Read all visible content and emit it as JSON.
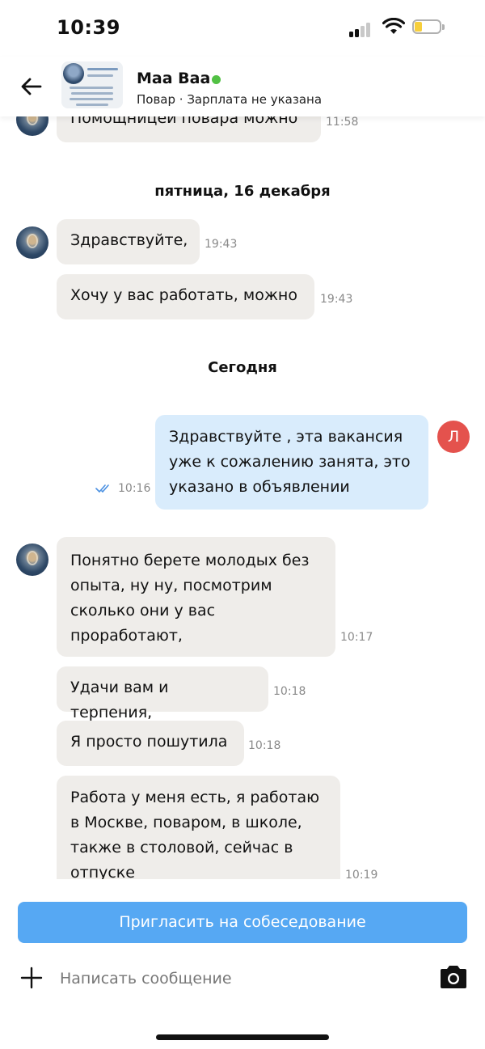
{
  "status_bar": {
    "time": "10:39"
  },
  "header": {
    "contact_name": "Маа Ваа",
    "subtitle": "Повар · Зарплата не указана",
    "online_color": "#52c144"
  },
  "messages": [
    {
      "direction": "in",
      "text": "Помощницей повара можно",
      "time": "11:58"
    },
    {
      "type": "date",
      "text": "пятница, 16 декабря"
    },
    {
      "direction": "in",
      "text": "Здравствуйте,",
      "time": "19:43"
    },
    {
      "direction": "in",
      "text": "Хочу у вас работать, можно",
      "time": "19:43"
    },
    {
      "type": "date",
      "text": "Сегодня"
    },
    {
      "direction": "out",
      "text": "Здравствуйте , эта вакансия уже к сожалению занята, это указано в объявлении",
      "time": "10:16",
      "status": "read",
      "avatar_letter": "Л"
    },
    {
      "direction": "in",
      "text": "Понятно берете молодых без опыта, ну ну, посмотрим сколько они у вас проработают,",
      "time": "10:17"
    },
    {
      "direction": "in",
      "text": "Удачи вам и терпения,",
      "time": "10:18"
    },
    {
      "direction": "in",
      "text": "Я просто пошутила",
      "time": "10:18"
    },
    {
      "direction": "in",
      "text": "Работа у меня есть, я работаю в Москве, поваром, в школе, также в столовой, сейчас в отпуске",
      "time": "10:19"
    }
  ],
  "actions": {
    "invite_label": "Пригласить на собеседование"
  },
  "composer": {
    "placeholder": "Написать сообщение"
  },
  "colors": {
    "incoming_bubble": "#efedea",
    "outgoing_bubble": "#d9ecfc",
    "accent_button": "#56a8f3",
    "my_avatar": "#e4524d",
    "read_check": "#4a90e2"
  },
  "icons": {
    "back": "arrow-left-icon",
    "plus": "plus-icon",
    "camera": "camera-icon",
    "read_status": "double-check-icon"
  }
}
